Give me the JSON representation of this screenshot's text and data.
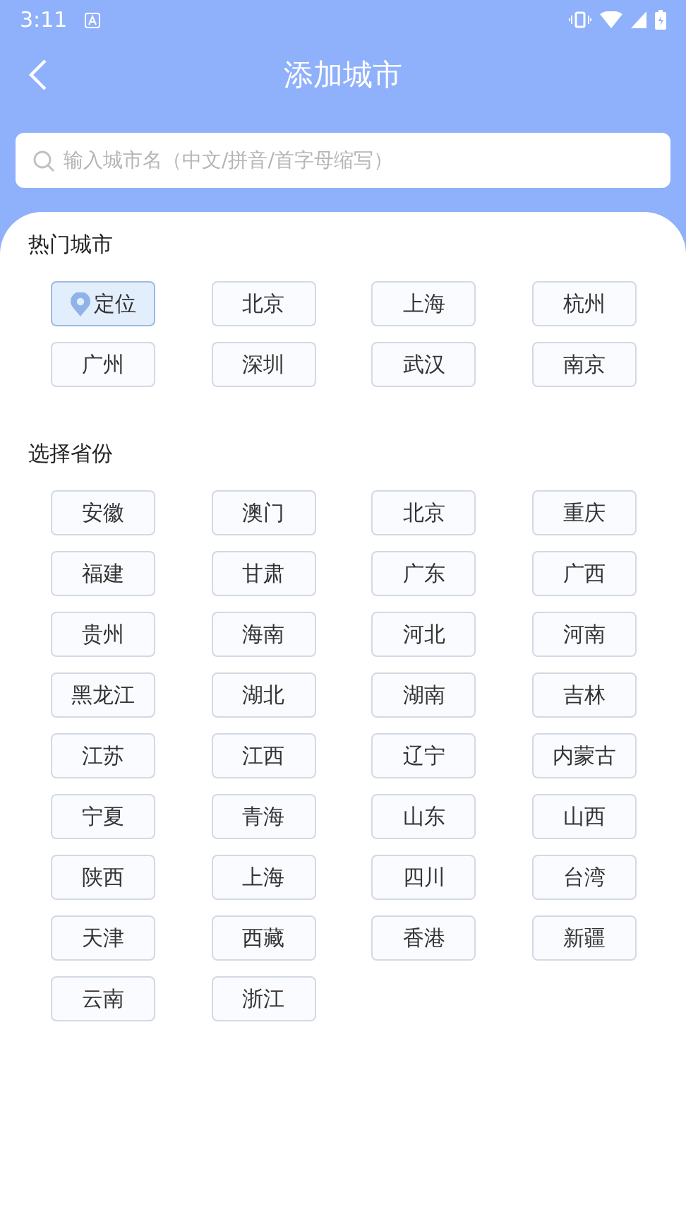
{
  "status_bar": {
    "time": "3:11"
  },
  "header": {
    "title": "添加城市"
  },
  "search": {
    "placeholder": "输入城市名（中文/拼音/首字母缩写）"
  },
  "hot_cities": {
    "title": "热门城市",
    "items": [
      {
        "label": "定位",
        "kind": "location",
        "selected": true
      },
      {
        "label": "北京",
        "kind": "city",
        "selected": false
      },
      {
        "label": "上海",
        "kind": "city",
        "selected": false
      },
      {
        "label": "杭州",
        "kind": "city",
        "selected": false
      },
      {
        "label": "广州",
        "kind": "city",
        "selected": false
      },
      {
        "label": "深圳",
        "kind": "city",
        "selected": false
      },
      {
        "label": "武汉",
        "kind": "city",
        "selected": false
      },
      {
        "label": "南京",
        "kind": "city",
        "selected": false
      }
    ]
  },
  "provinces": {
    "title": "选择省份",
    "items": [
      "安徽",
      "澳门",
      "北京",
      "重庆",
      "福建",
      "甘肃",
      "广东",
      "广西",
      "贵州",
      "海南",
      "河北",
      "河南",
      "黑龙江",
      "湖北",
      "湖南",
      "吉林",
      "江苏",
      "江西",
      "辽宁",
      "内蒙古",
      "宁夏",
      "青海",
      "山东",
      "山西",
      "陕西",
      "上海",
      "四川",
      "台湾",
      "天津",
      "西藏",
      "香港",
      "新疆",
      "云南",
      "浙江"
    ]
  }
}
